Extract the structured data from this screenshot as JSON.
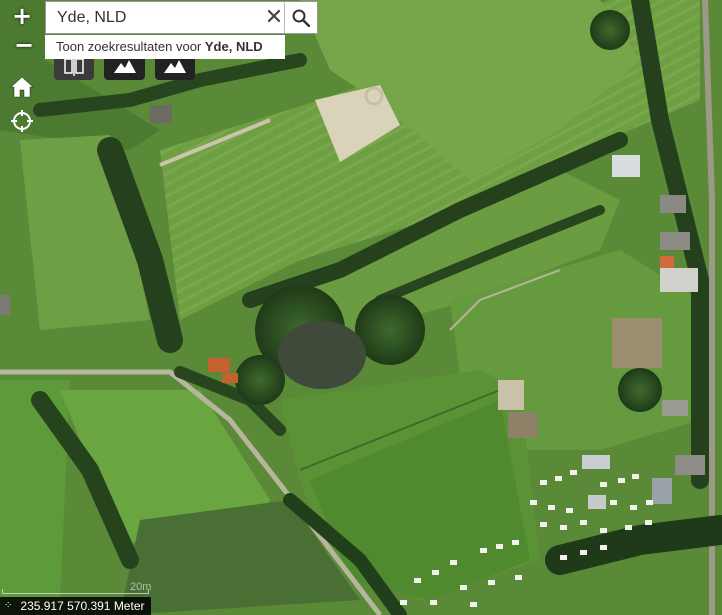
{
  "search": {
    "value": "Yde, NLD",
    "clear_icon": "close-icon",
    "search_icon": "search-icon"
  },
  "suggestion": {
    "prefix": "Toon zoekresultaten voor ",
    "term": "Yde, NLD"
  },
  "controls": {
    "zoom_in": "+",
    "zoom_out": "−",
    "home_icon": "home-icon",
    "locate_icon": "locate-crosshair-icon"
  },
  "toolbar": {
    "buttons": [
      "swipe-compare-icon",
      "mountain-icon",
      "mountain-icon"
    ]
  },
  "status": {
    "coordinates": "235.917 570.391 Meter",
    "scale_text": "20m"
  },
  "colors": {
    "field_green": "#5f8d3a",
    "bright_grass": "#7fad4c",
    "tree_dark": "#2b4a22",
    "pond": "#3f4a3b",
    "sand": "#d9d3b9"
  }
}
